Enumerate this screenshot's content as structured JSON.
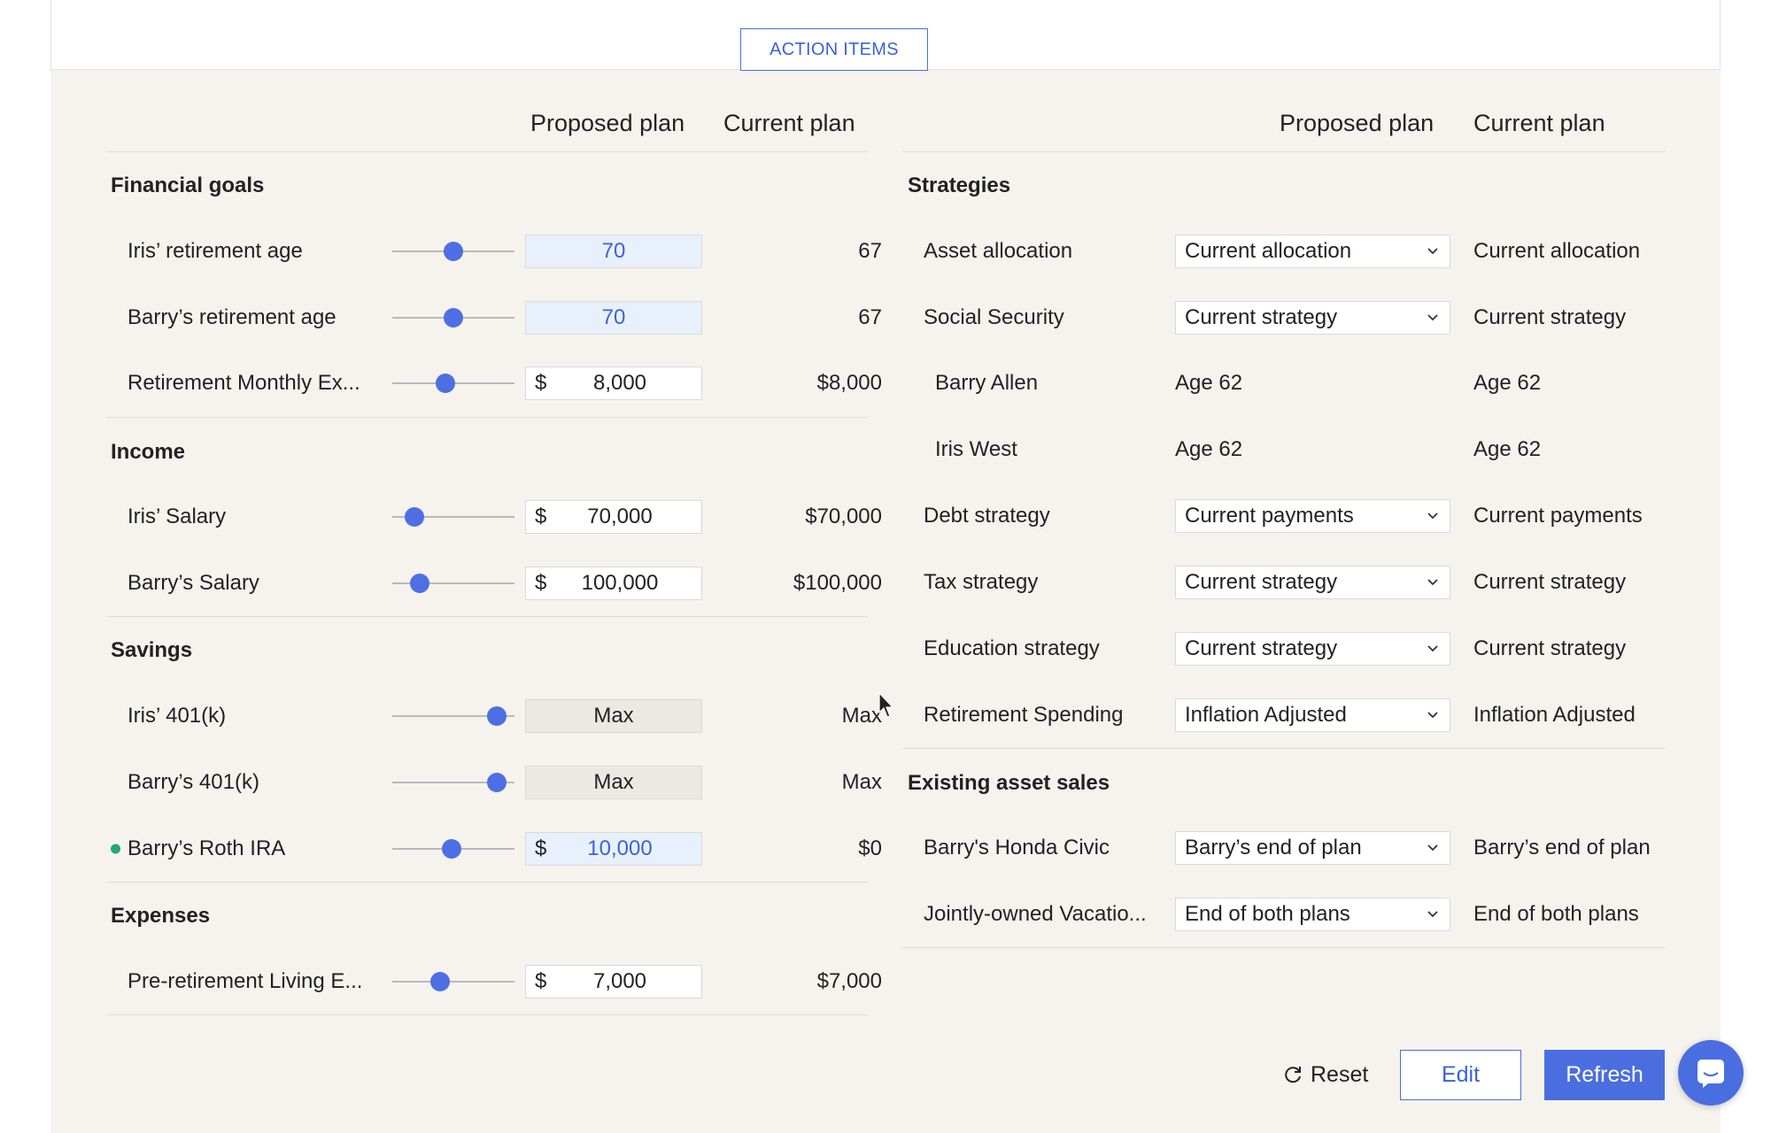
{
  "action_items_label": "ACTION ITEMS",
  "left": {
    "col_proposed": "Proposed plan",
    "col_current": "Current plan",
    "sections": {
      "financial_goals": "Financial goals",
      "income": "Income",
      "savings": "Savings",
      "expenses": "Expenses"
    },
    "rows": {
      "iris_ret_age": {
        "label": "Iris’ retirement age",
        "proposed": "70",
        "current": "67",
        "slider": 0.5
      },
      "barry_ret_age": {
        "label": "Barry’s retirement age",
        "proposed": "70",
        "current": "67",
        "slider": 0.5
      },
      "ret_monthly": {
        "label": "Retirement Monthly Ex...",
        "currency": "$",
        "proposed": "8,000",
        "current": "$8,000",
        "slider": 0.42
      },
      "iris_salary": {
        "label": "Iris’ Salary",
        "currency": "$",
        "proposed": "70,000",
        "current": "$70,000",
        "slider": 0.12
      },
      "barry_salary": {
        "label": "Barry’s Salary",
        "currency": "$",
        "proposed": "100,000",
        "current": "$100,000",
        "slider": 0.17
      },
      "iris_401k": {
        "label": "Iris’ 401(k)",
        "proposed": "Max",
        "current": "Max",
        "slider": 0.92
      },
      "barry_401k": {
        "label": "Barry’s 401(k)",
        "proposed": "Max",
        "current": "Max",
        "slider": 0.92
      },
      "barry_roth": {
        "label": "Barry’s Roth IRA",
        "currency": "$",
        "proposed": "10,000",
        "current": "$0",
        "slider": 0.48
      },
      "pre_ret_living": {
        "label": "Pre-retirement Living E...",
        "currency": "$",
        "proposed": "7,000",
        "current": "$7,000",
        "slider": 0.37
      }
    }
  },
  "right": {
    "col_proposed": "Proposed plan",
    "col_current": "Current plan",
    "sections": {
      "strategies": "Strategies",
      "existing_asset_sales": "Existing asset sales"
    },
    "rows": {
      "asset_allocation": {
        "label": "Asset allocation",
        "proposed": "Current allocation",
        "current": "Current allocation"
      },
      "social_security": {
        "label": "Social Security",
        "proposed": "Current strategy",
        "current": "Current strategy"
      },
      "barry_allen": {
        "label": "Barry Allen",
        "proposed": "Age 62",
        "current": "Age 62"
      },
      "iris_west": {
        "label": "Iris West",
        "proposed": "Age 62",
        "current": "Age 62"
      },
      "debt_strategy": {
        "label": "Debt strategy",
        "proposed": "Current payments",
        "current": "Current payments"
      },
      "tax_strategy": {
        "label": "Tax strategy",
        "proposed": "Current strategy",
        "current": "Current strategy"
      },
      "education_strategy": {
        "label": "Education strategy",
        "proposed": "Current strategy",
        "current": "Current strategy"
      },
      "retirement_spending": {
        "label": "Retirement Spending",
        "proposed": "Inflation Adjusted",
        "current": "Inflation Adjusted"
      },
      "honda_civic": {
        "label": "Barry's Honda Civic",
        "proposed": "Barry’s end of plan",
        "current": "Barry’s end of plan"
      },
      "vacation": {
        "label": "Jointly-owned Vacatio...",
        "proposed": "End of both plans",
        "current": "End of both plans"
      }
    }
  },
  "footer": {
    "reset": "Reset",
    "edit": "Edit",
    "refresh": "Refresh"
  },
  "icons": {
    "reset": "refresh-cycle-icon",
    "chevron": "chevron-down-icon",
    "chat": "chat-bubble-icon",
    "cursor": "mouse-pointer-icon"
  },
  "colors": {
    "accent": "#4a6ee0",
    "panel_bg": "#f6f3ef",
    "highlight_field": "#e8f0fc",
    "status_dot": "#20a67e"
  }
}
